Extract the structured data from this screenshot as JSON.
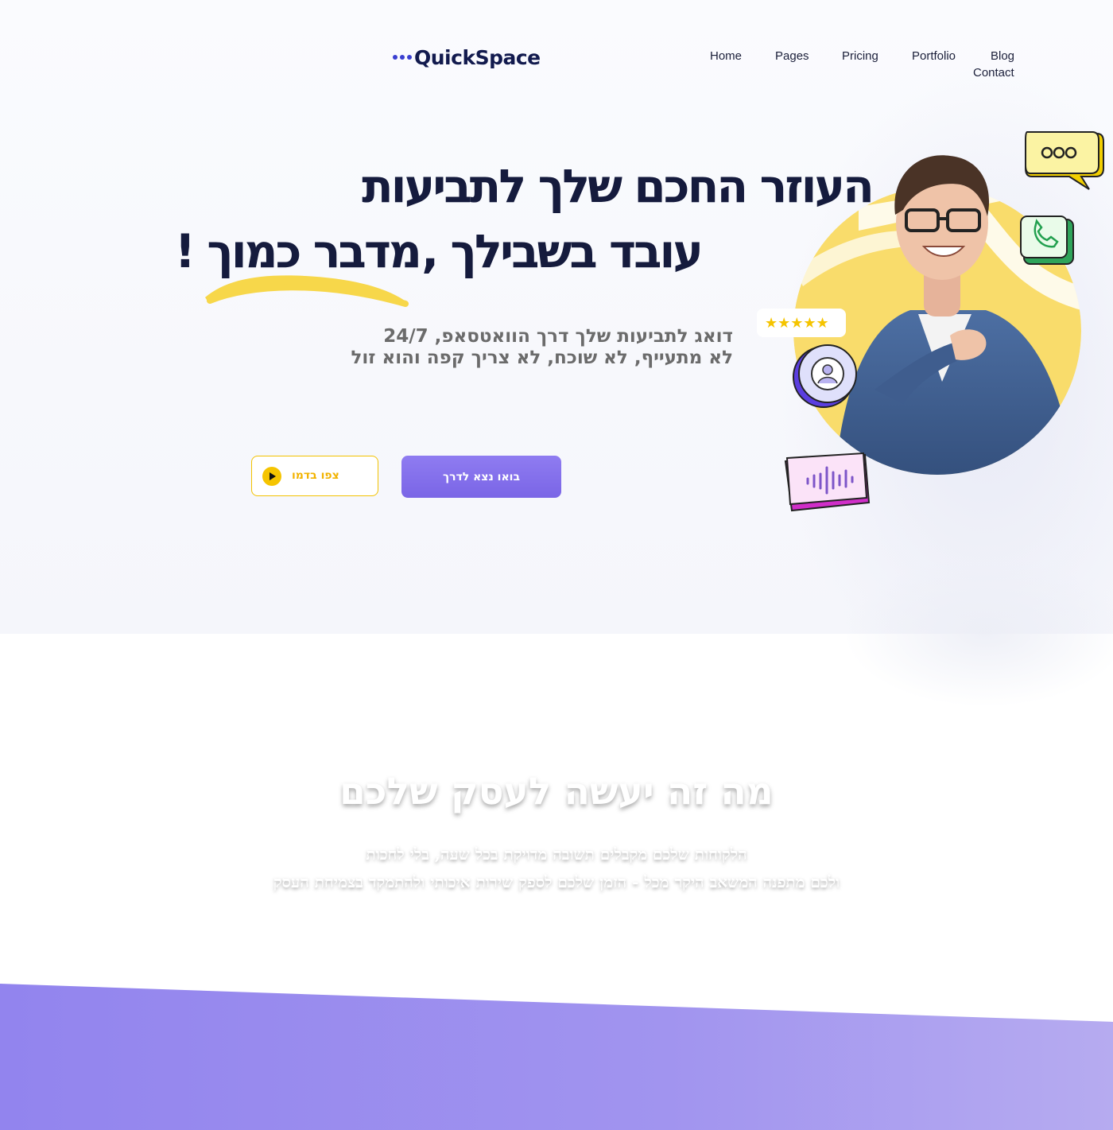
{
  "brand": {
    "name": "QuickSpace"
  },
  "nav": {
    "items": [
      "Home",
      "Pages",
      "Pricing",
      "Portfolio",
      "Blog",
      "Contact"
    ]
  },
  "hero": {
    "headline_line1": "העוזר החכם שלך לתביעות",
    "headline_line2a": "עובד בשבילך ,",
    "headline_line2b": "מדבר כמוך !",
    "subtitle_line1": "דואג לתביעות שלך דרך הוואטסאפ, 24/7",
    "subtitle_line2": "לא מתעייף, לא שוכח, לא צריך קפה והוא זול",
    "cta_primary": "בואו נצא לדרך",
    "cta_demo": "צפו בדמו",
    "rating_stars": 5
  },
  "features": {
    "title": "מה זה יעשה לעסק שלכם",
    "text_line1": "הלקוחות שלכם מקבלים תשובה מדויקת בכל שעה, בלי לחכות",
    "text_line2": "ולכם מתפנה המשאב היקר מכל - הזמן שלכם לספק שירות איכותי ולהתמקד בצמיחת העסק"
  },
  "colors": {
    "primary": "#7c68e8",
    "accent_yellow": "#f5c400",
    "headline": "#151b3d",
    "band_start": "#9284ee",
    "band_end": "#b6abf0"
  }
}
